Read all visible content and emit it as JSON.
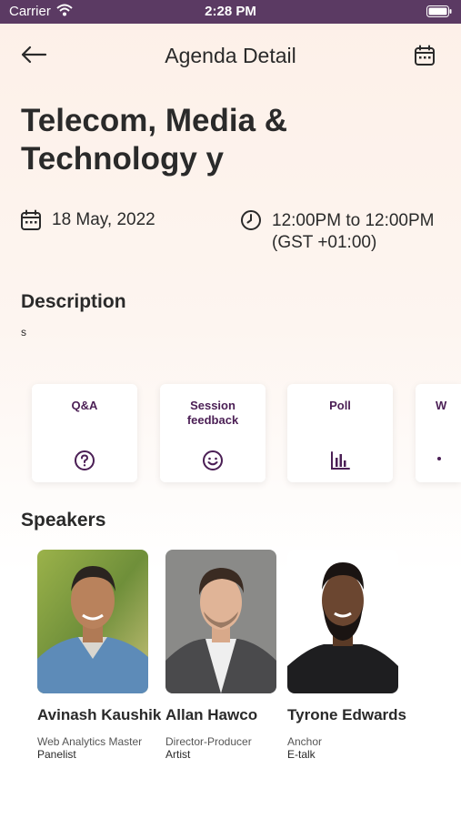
{
  "status_bar": {
    "carrier": "Carrier",
    "time": "2:28 PM"
  },
  "header": {
    "title": "Agenda Detail"
  },
  "session": {
    "title": "Telecom, Media & Technology y",
    "date": "18 May, 2022",
    "time_line1": "12:00PM to 12:00PM",
    "time_line2": "(GST +01:00)"
  },
  "description": {
    "heading": "Description",
    "body": "s"
  },
  "feature_cards": [
    {
      "label": "Q&A",
      "icon": "question-icon"
    },
    {
      "label": "Session feedback",
      "icon": "smiley-icon"
    },
    {
      "label": "Poll",
      "icon": "bar-chart-icon"
    },
    {
      "label": "W",
      "icon": "partial-icon"
    }
  ],
  "speakers": {
    "heading": "Speakers",
    "items": [
      {
        "name": "Avinash Kaushik",
        "role": "Web Analytics Master",
        "org": "Panelist"
      },
      {
        "name": "Allan Hawco",
        "role": "Director-Producer",
        "org": "Artist"
      },
      {
        "name": "Tyrone Edwards",
        "role": "Anchor",
        "org": "E-talk"
      }
    ]
  },
  "colors": {
    "accent": "#4b1f55",
    "status_bar": "#5b3a63"
  }
}
